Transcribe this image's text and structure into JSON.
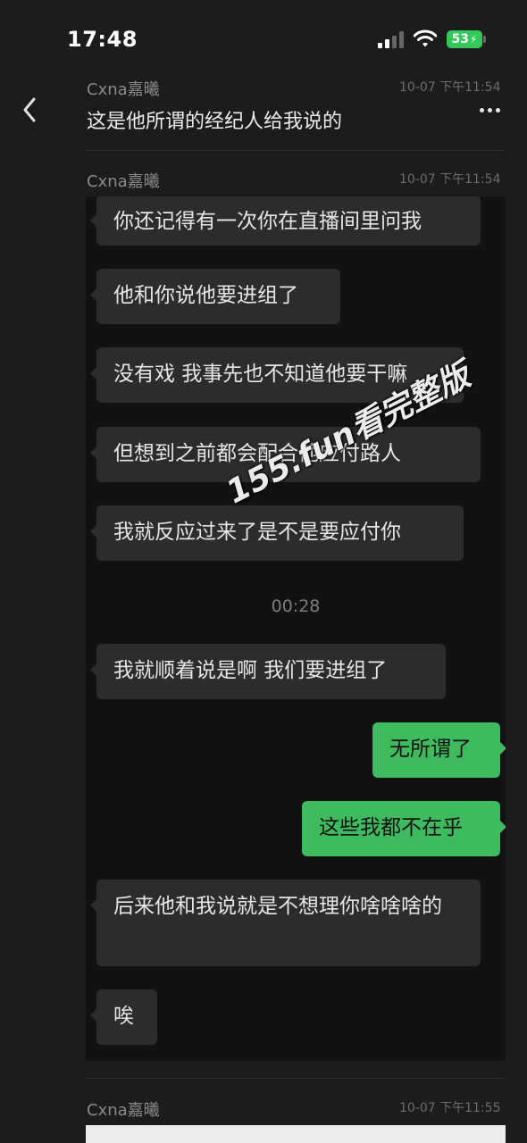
{
  "status_bar": {
    "time": "17:48",
    "battery_level": "53"
  },
  "header": {
    "back_icon": "chevron-left-icon",
    "more_icon": "ellipsis-icon"
  },
  "messages": [
    {
      "sender": "Cxna嘉曦",
      "timestamp": "10-07 下午11:54",
      "text": "这是他所谓的经纪人给我说的"
    },
    {
      "sender": "Cxna嘉曦",
      "timestamp": "10-07 下午11:54"
    },
    {
      "sender": "Cxna嘉曦",
      "timestamp": "10-07 下午11:55"
    }
  ],
  "screenshot": {
    "bubbles": [
      {
        "side": "in",
        "text": "你还记得有一次你在直播间里问我"
      },
      {
        "side": "in",
        "text": "他和你说他要进组了"
      },
      {
        "side": "in",
        "text": "没有戏 我事先也不知道他要干嘛"
      },
      {
        "side": "in",
        "text": "但想到之前都会配合他应付路人"
      },
      {
        "side": "in",
        "text": "我就反应过来了是不是要应付你"
      },
      {
        "side": "in",
        "text": "我就顺着说是啊 我们要进组了"
      },
      {
        "side": "out",
        "text": "无所谓了"
      },
      {
        "side": "out",
        "text": "这些我都不在乎"
      },
      {
        "side": "in",
        "text": "后来他和我说就是不想理你啥啥啥的"
      },
      {
        "side": "in",
        "text": "唉"
      }
    ],
    "timecode": "00:28",
    "watermark": "155.fun看完整版"
  },
  "colors": {
    "background": "#1c1c1c",
    "incoming_bubble": "#2c2c2c",
    "outgoing_bubble": "#3ebb5f",
    "battery": "#34c759"
  }
}
